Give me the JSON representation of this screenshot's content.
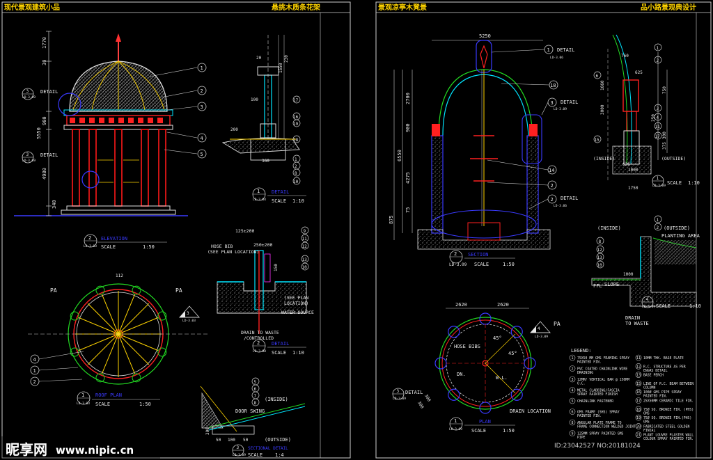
{
  "sheets": [
    {
      "title_left": "现代景观建筑小品",
      "title_right": "悬挑木质条花架"
    },
    {
      "title_left": "景观凉亭木凳景",
      "title_right": "品小路景观典设计"
    }
  ],
  "left": {
    "elevation": {
      "ref": "2",
      "sheet": "LD-3.03",
      "title": "ELEVATION",
      "scale": "SCALE",
      "ratio": "1:50",
      "detail_label": "DETAIL",
      "dims": [
        "1770",
        "30",
        "900",
        "5550",
        "4980",
        "340",
        "5"
      ],
      "tags": [
        "1",
        "2",
        "3",
        "4",
        "5"
      ],
      "detail_refs": [
        {
          "n": "3",
          "s": "LD-3.09"
        },
        {
          "n": "3",
          "s": "LD-3.09"
        }
      ]
    },
    "plan": {
      "ref": "1",
      "sheet": "LD-3.03",
      "title": "ROOF PLAN",
      "scale": "SCALE",
      "ratio": "1:50",
      "pa": [
        "PA",
        "PA"
      ],
      "dim": "112",
      "tags": [
        "4",
        "1",
        "2"
      ],
      "ref_tag": {
        "n": "3",
        "s": "LD-3.03"
      }
    },
    "detail1": {
      "ref": "1",
      "sheet": "LD-3.04",
      "title": "DETAIL",
      "scale": "SCALE",
      "ratio": "1:10",
      "dims": [
        "20",
        "230",
        "350",
        "150",
        "1550",
        "20",
        "100",
        "360",
        "1200",
        "50",
        "200",
        "250"
      ],
      "tags": [
        "17",
        "16",
        "18",
        "19",
        "1",
        "2",
        "3",
        "8",
        "10"
      ]
    },
    "detail2": {
      "ref": "2",
      "sheet": "LD-3.08",
      "title": "DETAIL",
      "scale": "SCALE",
      "ratio": "1:10",
      "dims": [
        "125±200",
        "250±200",
        "150",
        "100"
      ],
      "tags": [
        "9",
        "11",
        "12",
        "13",
        "10"
      ],
      "notes": [
        "HOSE BIB",
        "(SEE PLAN LOCATION)",
        "(SEE PLAN",
        "LOCATION)",
        "WATER SOURCE",
        "DRAIN TO WASTE",
        "/CONTROLLED"
      ]
    },
    "detail3": {
      "ref": "3",
      "sheet": "LD-3.09",
      "title": "SECTIONAL DETAIL",
      "scale": "SCALE",
      "ratio": "1:4",
      "tags": [
        "5",
        "6",
        "7",
        "8"
      ],
      "notes": [
        "(INSIDE)",
        "DOOR SWING",
        "(OUTSIDE)"
      ],
      "dims": [
        "50",
        "100",
        "50",
        "50",
        "300"
      ]
    }
  },
  "right": {
    "elevation": {
      "ref": "2",
      "sheet": "LD-3.09",
      "title": "SECTION",
      "scale": "SCALE",
      "ratio": "1:50",
      "dims": [
        "5250",
        "2700",
        "900",
        "6550",
        "4275",
        "75",
        "875"
      ],
      "tags": [
        "18",
        "14",
        "2"
      ],
      "details": [
        {
          "label": "DETAIL",
          "s": "LD-3.06"
        },
        {
          "label": "DETAIL",
          "s": "LD-3.09"
        },
        {
          "label": "DETAIL",
          "s": "LD-3.06"
        }
      ],
      "detail_nums": [
        "1",
        "3",
        "2"
      ]
    },
    "section": {
      "ref": "1",
      "sheet": "LD-3.09",
      "scale": "SCALE",
      "ratio": "1:10",
      "dims": [
        "760",
        "625",
        "1660",
        "3000",
        "250",
        "750",
        "300",
        "375",
        "626",
        "1000",
        "1750",
        "50",
        "500",
        "50",
        "60"
      ],
      "tags": [
        "1",
        "2",
        "3",
        "4",
        "6",
        "11",
        "15",
        "17"
      ],
      "notes": [
        "(INSIDE)",
        "(OUTSIDE)"
      ]
    },
    "section2": {
      "ref": "4",
      "sheet": "LD-3.09",
      "scale": "SCALE",
      "ratio": "1:10",
      "tags": [
        "1",
        "2",
        "8",
        "12",
        "13",
        "10"
      ],
      "notes": [
        "(INSIDE)",
        "(OUTSIDE)",
        "PLANTING AREA",
        "FFL",
        "SLOPE",
        "DRAIN",
        "TO WASTE"
      ],
      "dims": [
        "1000"
      ]
    },
    "plan": {
      "ref": "1",
      "sheet": "LD-3.09",
      "title": "PLAN",
      "scale": "SCALE",
      "ratio": "1:50",
      "dims": [
        "2620",
        "2620",
        "45°",
        "45°",
        "300",
        "300"
      ],
      "notes": [
        "HOSE BIBS",
        "DN.",
        "W.L.",
        "DRAIN LOCATION",
        "DETAIL"
      ],
      "pa": "PA",
      "pa_ref": {
        "n": "4",
        "s": "LD-3.09"
      },
      "detail_ref": {
        "n": "3",
        "s": "LD-3.09"
      }
    },
    "legend": {
      "title": "LEGEND:",
      "items": [
        {
          "n": "1",
          "t": "75X50 MM GMS FRAMING SPRAY PAINTED FIN."
        },
        {
          "n": "2",
          "t": "PVC COATED CHAINLINK WIRE DRAINING"
        },
        {
          "n": "3",
          "t": "12MM/ VERTICAL BAR @ 150MM O.C."
        },
        {
          "n": "4",
          "t": "METAL CLADDING/FASCIA SPRAY PAINTED FINISH"
        },
        {
          "n": "5",
          "t": "CHAINLINK FASTENER"
        },
        {
          "n": "6",
          "t": "GMS FRAME (SHS) SPRAY PAINTED FIN."
        },
        {
          "n": "8",
          "t": "ANGULAR PLATE FRAME TO FRAME CONNECTION WELDED JOINT"
        },
        {
          "n": "9",
          "t": "125MM SPRAY PAINTED GMS PIPE"
        },
        {
          "n": "11",
          "t": "10MM THK. BASE PLATE"
        },
        {
          "n": "12",
          "t": "R.C. STRUCTURE AS PER ENGRS DETAIL"
        },
        {
          "n": "13",
          "t": "BASE PERCH"
        },
        {
          "n": "15",
          "t": "LINE OF R.C. BEAM BETWEEN COLUMN"
        },
        {
          "n": "16",
          "t": "100Ø GMS PIPE SPRAY PAINTED FIN."
        },
        {
          "n": "17",
          "t": "25X50MM CERAMIC TILE FIN."
        },
        {
          "n": "18",
          "t": "75Ø SQ. BRONZE FIN. (PHS) GMS"
        },
        {
          "n": "19",
          "t": "75Ø SQ. BRONZE FIN.(PHS) GMS"
        },
        {
          "n": "20",
          "t": "FABRICATED STEEL GOLDEN FINIAL"
        },
        {
          "n": "21",
          "t": "PLANT LOUVRE PLASTER WALL COLOUR SPRAY PAINTED FIN."
        }
      ]
    }
  },
  "watermark": {
    "logo": "昵享网",
    "url": "www.nipic.cn",
    "id": "ID:23042527 NO:20181024"
  },
  "colors": {
    "bg": "#000000",
    "frame": "#cfcfcf",
    "column": "#ff1a1a",
    "cyan": "#00e5ff",
    "yellow": "#ffd400",
    "blue": "#3a3aff",
    "green": "#22d922",
    "magenta": "#ff33ff"
  }
}
